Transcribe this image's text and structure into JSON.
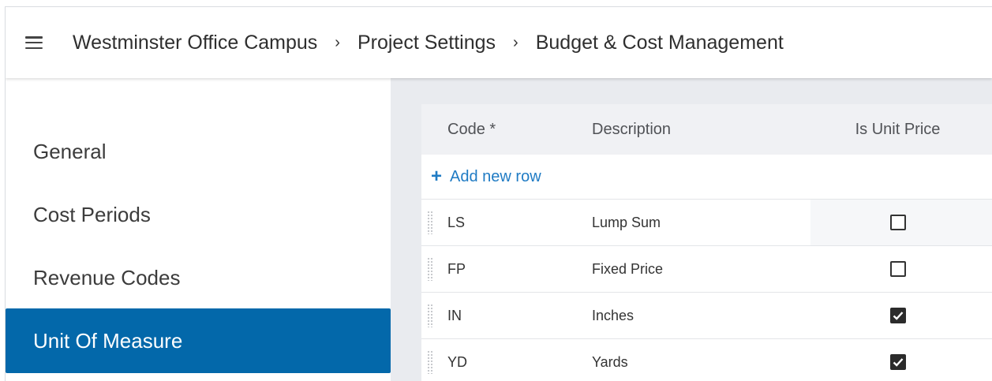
{
  "breadcrumb": {
    "project": "Westminster Office Campus",
    "settings": "Project Settings",
    "current": "Budget & Cost Management",
    "separator": "›"
  },
  "sidebar": {
    "items": [
      {
        "label": "General",
        "active": false
      },
      {
        "label": "Cost Periods",
        "active": false
      },
      {
        "label": "Revenue Codes",
        "active": false
      },
      {
        "label": "Unit Of Measure",
        "active": true
      }
    ]
  },
  "table": {
    "columns": {
      "code": "Code *",
      "description": "Description",
      "is_unit_price": "Is Unit Price"
    },
    "add_row_label": "Add new row",
    "rows": [
      {
        "code": "LS",
        "description": "Lump Sum",
        "is_unit_price": false
      },
      {
        "code": "FP",
        "description": "Fixed Price",
        "is_unit_price": false
      },
      {
        "code": "IN",
        "description": "Inches",
        "is_unit_price": true
      },
      {
        "code": "YD",
        "description": "Yards",
        "is_unit_price": true
      }
    ]
  },
  "colors": {
    "accent": "#0368aa",
    "link": "#1f7bc4",
    "content_bg": "#e9ebef"
  }
}
